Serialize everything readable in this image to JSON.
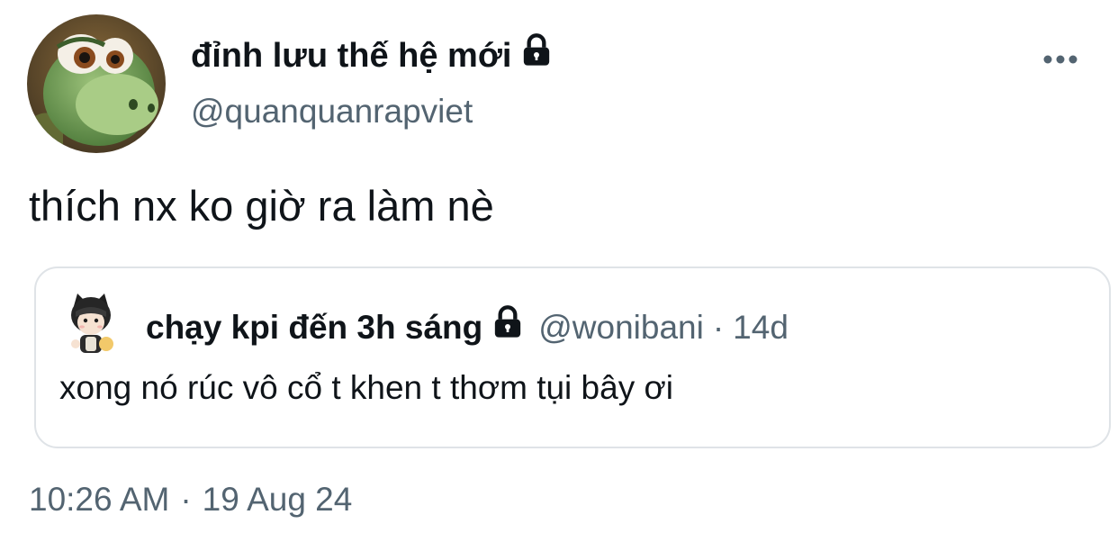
{
  "tweet": {
    "author": {
      "display_name": "đỉnh lưu thế hệ mới",
      "handle": "@quanquanrapviet",
      "locked": true,
      "avatar": "dinosaur-avatar"
    },
    "text": "thích nx ko giờ ra làm nè",
    "time": "10:26 AM",
    "separator": "·",
    "date": "19 Aug 24",
    "more_icon": "more-horizontal-icon"
  },
  "quote": {
    "display_name": "chạy kpi đến 3h sáng",
    "handle": "@wonibani",
    "separator": "·",
    "age": "14d",
    "locked": true,
    "avatar": "cat-hood-avatar",
    "text": "xong nó rúc vô cổ t khen t thơm tụi bây ơi"
  },
  "colors": {
    "text_primary": "#0f1419",
    "text_secondary": "#536471",
    "border": "#dfe3e7",
    "background": "#ffffff"
  }
}
